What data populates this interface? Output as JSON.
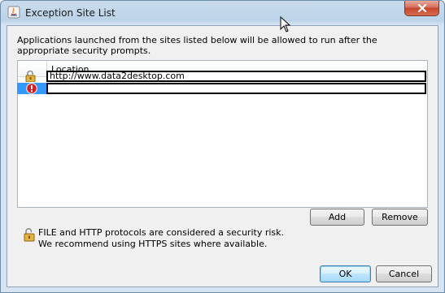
{
  "window": {
    "title": "Exception Site List",
    "app_icon": "java-icon",
    "close_icon": "close-icon"
  },
  "description": "Applications launched from the sites listed below will be allowed to run after the appropriate security prompts.",
  "table": {
    "columns": [
      "",
      "Location"
    ],
    "rows": [
      {
        "icon": "unlocked-padlock-icon",
        "location": "http://www.data2desktop.com"
      },
      {
        "icon": "error-icon",
        "location": ""
      }
    ]
  },
  "buttons": {
    "add": "Add",
    "remove": "Remove",
    "ok": "OK",
    "cancel": "Cancel"
  },
  "security_note": {
    "icon": "unlocked-padlock-icon",
    "line1": "FILE and HTTP protocols are considered a security risk.",
    "line2": "We recommend using HTTPS sites where available."
  }
}
